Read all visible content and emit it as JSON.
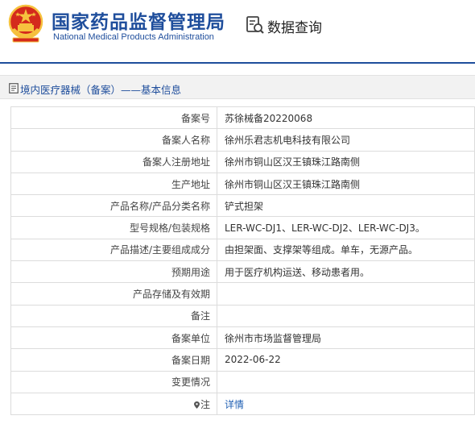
{
  "header": {
    "title_cn": "国家药品监督管理局",
    "title_en": "National Medical Products Administration",
    "query_label": "数据查询",
    "colors": {
      "brand_blue": "#1f4e9c",
      "emblem_red": "#d42a1c",
      "emblem_gold": "#f6c23e"
    }
  },
  "section": {
    "title": "境内医疗器械（备案）——基本信息",
    "icon": "document-icon"
  },
  "rows": [
    {
      "label": "备案号",
      "value": "苏徐械备20220068"
    },
    {
      "label": "备案人名称",
      "value": "徐州乐君志机电科技有限公司"
    },
    {
      "label": "备案人注册地址",
      "value": "徐州市铜山区汉王镇珠江路南侧"
    },
    {
      "label": "生产地址",
      "value": "徐州市铜山区汉王镇珠江路南侧"
    },
    {
      "label": "产品名称/产品分类名称",
      "value": "铲式担架"
    },
    {
      "label": "型号规格/包装规格",
      "value": "LER-WC-DJ1、LER-WC-DJ2、LER-WC-DJ3。"
    },
    {
      "label": "产品描述/主要组成成分",
      "value": "由担架面、支撑架等组成。单车，无源产品。"
    },
    {
      "label": "预期用途",
      "value": "用于医疗机构运送、移动患者用。"
    },
    {
      "label": "产品存储及有效期",
      "value": ""
    },
    {
      "label": "备注",
      "value": ""
    },
    {
      "label": "备案单位",
      "value": "徐州市市场监督管理局"
    },
    {
      "label": "备案日期",
      "value": "2022-06-22"
    },
    {
      "label": "变更情况",
      "value": ""
    }
  ],
  "note_row": {
    "label": "注",
    "link_text": "详情",
    "icon": "pin-icon"
  }
}
